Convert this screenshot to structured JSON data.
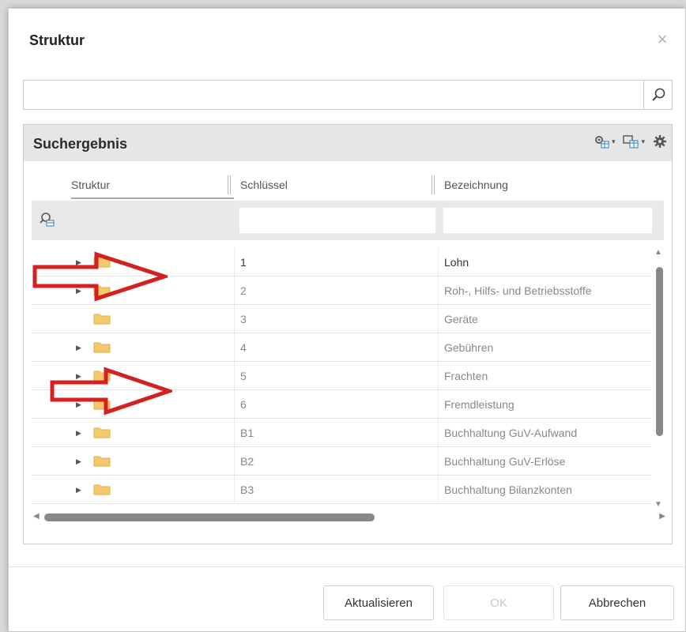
{
  "dialog": {
    "title": "Struktur",
    "close_symbol": "×"
  },
  "search": {
    "value": "",
    "placeholder": "",
    "icon": "search-icon"
  },
  "panel": {
    "title": "Suchergebnis",
    "tools": [
      "gear-table-icon",
      "table-settings-icon",
      "gear-icon"
    ],
    "caret": "▾"
  },
  "grid": {
    "columns": [
      "Struktur",
      "Schlüssel",
      "Bezeichnung"
    ],
    "filter_icon": "filter-search-icon",
    "rows": [
      {
        "key": "1",
        "name": "Lohn",
        "expandable": true
      },
      {
        "key": "2",
        "name": "Roh-, Hilfs- und Betriebsstoffe",
        "expandable": true
      },
      {
        "key": "3",
        "name": "Geräte",
        "expandable": false
      },
      {
        "key": "4",
        "name": "Gebühren",
        "expandable": true
      },
      {
        "key": "5",
        "name": "Frachten",
        "expandable": true
      },
      {
        "key": "6",
        "name": "Fremdleistung",
        "expandable": true
      },
      {
        "key": "B1",
        "name": "Buchhaltung GuV-Aufwand",
        "expandable": true
      },
      {
        "key": "B2",
        "name": "Buchhaltung GuV-Erlöse",
        "expandable": true
      },
      {
        "key": "B3",
        "name": "Buchhaltung Bilanzkonten",
        "expandable": true
      }
    ],
    "expander_symbol": "▶",
    "scroll_up": "▲",
    "scroll_down": "▼",
    "scroll_left": "◀",
    "scroll_right": "▶"
  },
  "buttons": {
    "refresh": "Aktualisieren",
    "ok": "OK",
    "cancel": "Abbrechen"
  },
  "colors": {
    "annotation_arrow": "#d42020",
    "folder": "#f3c96b"
  }
}
